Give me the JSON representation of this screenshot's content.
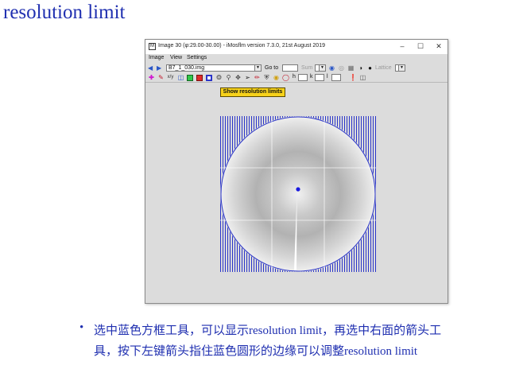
{
  "slide": {
    "title": "resolution limit"
  },
  "window": {
    "title": "Image 30 (φ:29.00-30.00) - iMosflm version 7.3.0, 21st August 2019",
    "app_icon_label": "M",
    "controls": {
      "minimize": "–",
      "maximize": "☐",
      "close": "✕"
    }
  },
  "menu": {
    "items": [
      "Image",
      "View",
      "Settings"
    ]
  },
  "toolbar": {
    "back_icon": "arrow-left",
    "forward_icon": "arrow-right",
    "image_file": "B7_1_030.img",
    "goto_label": "Go to",
    "sum_label": "Sum",
    "lattice_label": "Lattice",
    "h_label": "h",
    "k_label": "k",
    "l_label": "l"
  },
  "tooltip": {
    "text": "Show resolution limits"
  },
  "caption": {
    "bullet": "•",
    "line1": "选中蓝色方框工具，可以显示resolution limit，再选中右面的箭头工",
    "line2": "具，按下左键箭头指住蓝色圆形的边缘可以调整resolution limit"
  },
  "colors": {
    "accent_text": "#1f2fb0",
    "resolution_overlay": "#2b35c9",
    "tooltip_bg": "#f7d21a",
    "window_bg": "#dcdcdc"
  }
}
